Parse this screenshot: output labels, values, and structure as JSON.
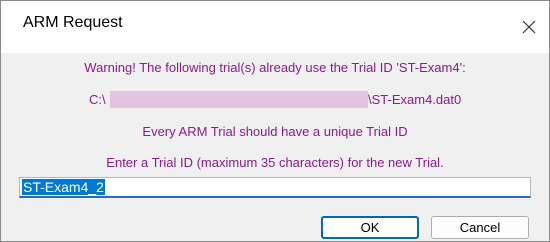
{
  "window": {
    "title": "ARM Request"
  },
  "message": {
    "warning": "Warning! The following trial(s) already use the Trial ID 'ST-Exam4':",
    "path_prefix": "C:\\",
    "path_suffix": "\\ST-Exam4.dat0",
    "unique_note": "Every ARM Trial should have a unique Trial ID",
    "prompt": "Enter a Trial ID (maximum 35 characters) for the new Trial."
  },
  "trial_id_input": {
    "value": "ST-Exam4_2"
  },
  "buttons": {
    "ok_label": "OK",
    "cancel_label": "Cancel"
  },
  "colors": {
    "message_text": "#8b1a8b",
    "selection": "#0078d7",
    "default_button_border": "#0067c0"
  },
  "icons": {
    "close": "close-icon"
  }
}
